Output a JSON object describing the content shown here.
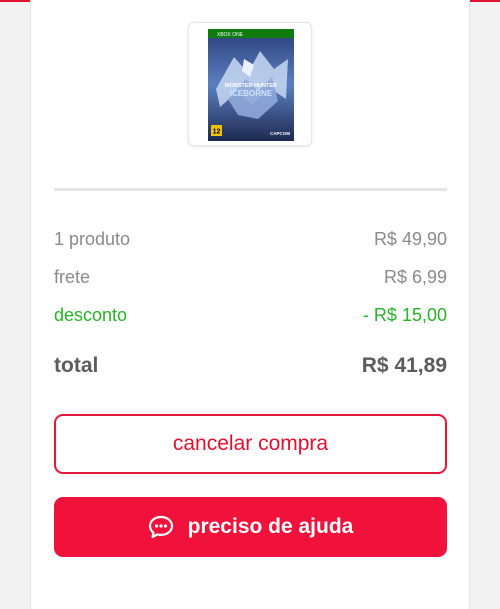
{
  "colors": {
    "accent": "#e0102f",
    "discount": "#27b327",
    "muted_text": "#8a8a8a",
    "dark_text": "#5c5c5c"
  },
  "product": {
    "platform_badge": "XBOX ONE",
    "title_line1": "MONSTER HUNTER",
    "title_line2": "ICEBORNE",
    "age_rating": "12",
    "publisher": "CAPCOM"
  },
  "summary": {
    "items_label": "1 produto",
    "items_value": "R$ 49,90",
    "shipping_label": "frete",
    "shipping_value": "R$ 6,99",
    "discount_label": "desconto",
    "discount_value": "- R$ 15,00",
    "total_label": "total",
    "total_value": "R$ 41,89"
  },
  "actions": {
    "cancel_label": "cancelar compra",
    "help_label": "preciso de ajuda",
    "help_icon": "chat-bubble-icon"
  }
}
